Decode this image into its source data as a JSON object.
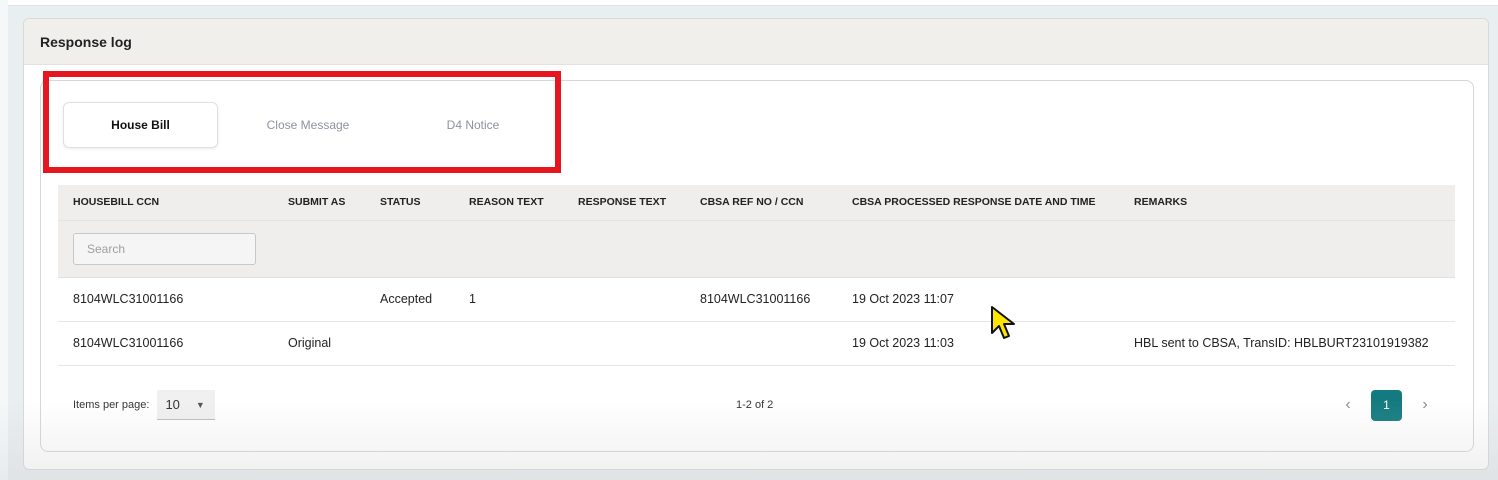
{
  "card": {
    "title": "Response log"
  },
  "tabs": [
    {
      "label": "House Bill",
      "active": true
    },
    {
      "label": "Close Message",
      "active": false
    },
    {
      "label": "D4 Notice",
      "active": false
    }
  ],
  "table": {
    "columns": [
      "HOUSEBILL CCN",
      "SUBMIT AS",
      "STATUS",
      "REASON TEXT",
      "RESPONSE TEXT",
      "CBSA REF NO / CCN",
      "CBSA PROCESSED RESPONSE DATE AND TIME",
      "REMARKS"
    ],
    "search_placeholder": "Search",
    "rows": [
      [
        "8104WLC31001166",
        "",
        "Accepted",
        "1",
        "",
        "8104WLC31001166",
        "19 Oct 2023 11:07",
        ""
      ],
      [
        "8104WLC31001166",
        "Original",
        "",
        "",
        "",
        "",
        "19 Oct 2023 11:03",
        "HBL sent to CBSA, TransID: HBLBURT23101919382"
      ]
    ]
  },
  "paginator": {
    "items_per_page_label": "Items per page:",
    "items_per_page_value": "10",
    "range_label": "1-2 of 2",
    "current_page": "1",
    "prev_glyph": "‹",
    "next_glyph": "›",
    "dropdown_glyph": "▼"
  },
  "colors": {
    "accent": "#137b7f",
    "highlight": "#e5161d",
    "cursor": "#ffe600"
  }
}
